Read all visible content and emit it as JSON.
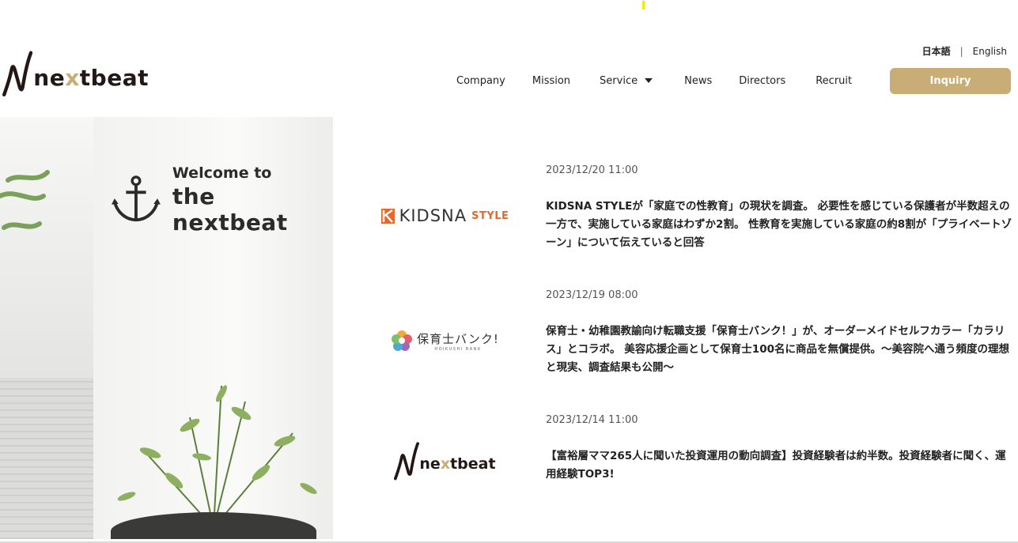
{
  "header": {
    "logo_text_pre": "ne",
    "logo_text_x": "x",
    "logo_text_post": "tbeat",
    "lang": {
      "ja": "日本語",
      "separator": "|",
      "en": "English"
    },
    "nav": [
      {
        "label": "Company"
      },
      {
        "label": "Mission"
      },
      {
        "label": "Service"
      },
      {
        "label": "News"
      },
      {
        "label": "Directors"
      },
      {
        "label": "Recruit"
      }
    ],
    "inquiry_label": "Inquiry",
    "accent_color": "#c9ad76"
  },
  "hero": {
    "welcome_line1": "Welcome to",
    "welcome_line2": "the nextbeat",
    "icon": "anchor-icon"
  },
  "news": [
    {
      "date": "2023/12/20 11:00",
      "logo": {
        "name": "KIDSNA",
        "suffix": "STYLE"
      },
      "title": "KIDSNA STYLEが「家庭での性教育」の現状を調査。 必要性を感じている保護者が半数超えの一方で、実施している家庭はわずか2割。 性教育を実施している家庭の約8割が「プライベートゾーン」について伝えていると回答"
    },
    {
      "date": "2023/12/19 08:00",
      "logo": {
        "name": "保育士バンク!",
        "suffix": "HOIKUSHI BANK"
      },
      "title": "保育士・幼稚園教諭向け転職支援「保育士バンク！」が、オーダーメイドセルフカラー「カラリス」とコラボ。 美容応援企画として保育士100名に商品を無償提供。〜美容院へ通う頻度の理想と現実、調査結果も公開〜"
    },
    {
      "date": "2023/12/14 11:00",
      "logo": {
        "name": "nextbeat"
      },
      "title": "【富裕層ママ265人に聞いた投資運用の動向調査】投資経験者は約半数。投資経験者に聞く、運用経験TOP3!"
    }
  ]
}
